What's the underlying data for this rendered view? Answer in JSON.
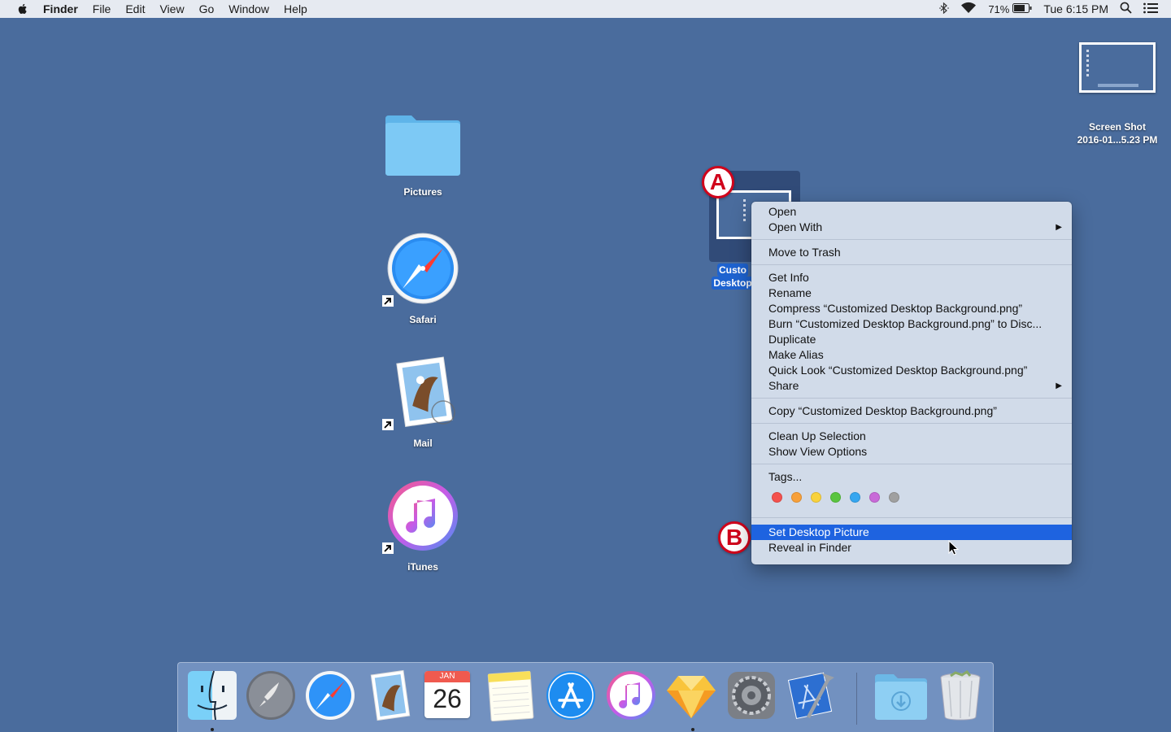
{
  "menubar": {
    "app_name": "Finder",
    "menus": [
      "File",
      "Edit",
      "View",
      "Go",
      "Window",
      "Help"
    ],
    "battery_percent": "71%",
    "clock": "Tue 6:15 PM",
    "icons": [
      "apple-icon",
      "bluetooth-icon",
      "wifi-icon",
      "battery-icon",
      "spotlight-icon",
      "notification-center-icon"
    ]
  },
  "desktop": {
    "icons": [
      {
        "label": "Pictures",
        "icon": "folder-icon"
      },
      {
        "label": "Safari",
        "icon": "safari-icon"
      },
      {
        "label": "Mail",
        "icon": "mail-icon"
      },
      {
        "label": "iTunes",
        "icon": "itunes-icon"
      }
    ],
    "screenshot_file": {
      "line1": "Screen Shot",
      "line2": "2016-01...5.23 PM"
    },
    "selected_file": {
      "line1": "Custo",
      "line2": "Desktop"
    }
  },
  "callouts": {
    "a": "A",
    "b": "B"
  },
  "context_menu": {
    "groups": [
      [
        {
          "label": "Open"
        },
        {
          "label": "Open With",
          "submenu": true
        }
      ],
      [
        {
          "label": "Move to Trash"
        }
      ],
      [
        {
          "label": "Get Info"
        },
        {
          "label": "Rename"
        },
        {
          "label": "Compress “Customized Desktop Background.png”"
        },
        {
          "label": "Burn “Customized Desktop Background.png” to Disc..."
        },
        {
          "label": "Duplicate"
        },
        {
          "label": "Make Alias"
        },
        {
          "label": "Quick Look “Customized Desktop Background.png”"
        },
        {
          "label": "Share",
          "submenu": true
        }
      ],
      [
        {
          "label": "Copy “Customized Desktop Background.png”"
        }
      ],
      [
        {
          "label": "Clean Up Selection"
        },
        {
          "label": "Show View Options"
        }
      ],
      [
        {
          "label": "Tags..."
        }
      ]
    ],
    "tag_colors": [
      "#f4514d",
      "#f7a03a",
      "#f9d23c",
      "#5ac53f",
      "#35a6f0",
      "#c86ad8",
      "#a0a0a0"
    ],
    "bottom_items": [
      {
        "label": "Set Desktop Picture",
        "highlighted": true
      },
      {
        "label": "Reveal in Finder"
      }
    ],
    "highlight_color": "#1e63e0"
  },
  "dock": {
    "calendar": {
      "month": "JAN",
      "day": "26"
    },
    "apps": [
      "finder-icon",
      "launchpad-icon",
      "safari-icon",
      "mail-icon",
      "calendar-icon",
      "notes-icon",
      "app-store-icon",
      "itunes-icon",
      "sketch-icon",
      "system-preferences-icon",
      "xcode-icon",
      "downloads-folder-icon",
      "trash-icon"
    ]
  }
}
